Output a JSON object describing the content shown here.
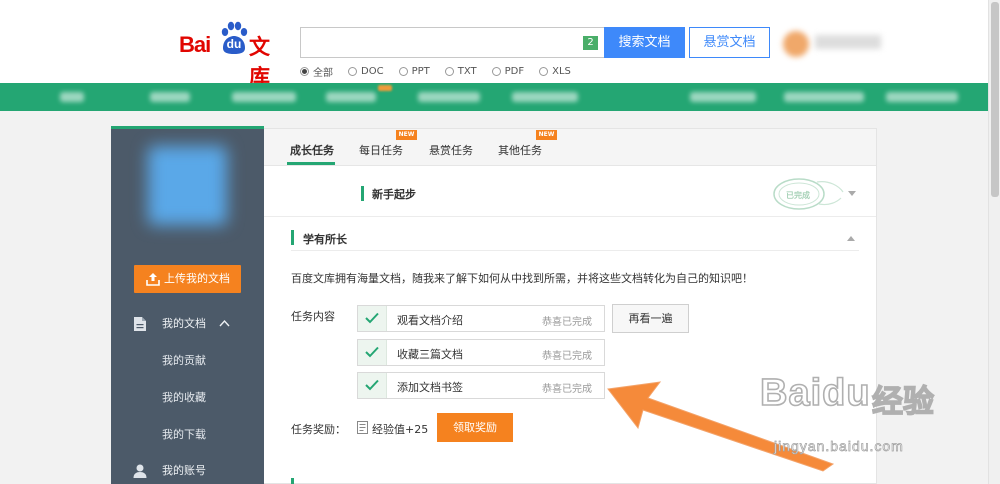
{
  "brand": {
    "logo_text_latin": "Bai",
    "logo_paw_text": "du",
    "logo_text_cn": "文库"
  },
  "search": {
    "count_badge": "2",
    "search_button": "搜索文档",
    "reward_button": "悬赏文档",
    "filters": [
      {
        "label": "全部",
        "selected": true
      },
      {
        "label": "DOC",
        "selected": false
      },
      {
        "label": "PPT",
        "selected": false
      },
      {
        "label": "TXT",
        "selected": false
      },
      {
        "label": "PDF",
        "selected": false
      },
      {
        "label": "XLS",
        "selected": false
      }
    ]
  },
  "sidebar": {
    "upload_button": "上传我的文档",
    "items": [
      {
        "label": "我的文档",
        "icon": "document-icon"
      },
      {
        "label": "我的账号",
        "icon": "person-icon"
      }
    ],
    "sub_items": [
      "我的贡献",
      "我的收藏",
      "我的下载"
    ]
  },
  "tabs": [
    {
      "label": "成长任务",
      "active": true,
      "new": false
    },
    {
      "label": "每日任务",
      "active": false,
      "new": true
    },
    {
      "label": "悬赏任务",
      "active": false,
      "new": false
    },
    {
      "label": "其他任务",
      "active": false,
      "new": true
    }
  ],
  "new_badge": "NEW",
  "sections": {
    "beginner_title": "新手起步",
    "learning_title": "学有所长",
    "description": "百度文库拥有海量文档，随我来了解下如何从中找到所需，并将这些文档转化为自己的知识吧！",
    "task_label": "任务内容",
    "tasks": [
      {
        "name": "观看文档介绍",
        "status": "恭喜已完成"
      },
      {
        "name": "收藏三篇文档",
        "status": "恭喜已完成"
      },
      {
        "name": "添加文档书签",
        "status": "恭喜已完成"
      }
    ],
    "review_button": "再看一遍",
    "reward_label": "任务奖励：",
    "reward_value": "经验值+25",
    "claim_button": "领取奖励"
  },
  "stamp_text": "已完成",
  "watermark": {
    "latin": "Baidu",
    "cn": "经验",
    "url": "jingyan.baidu.com"
  },
  "colors": {
    "brand_green": "#24a673",
    "accent_orange": "#f5821f",
    "search_blue": "#3e89fa",
    "sidebar_bg": "#4c5a69",
    "logo_red": "#e10601"
  }
}
